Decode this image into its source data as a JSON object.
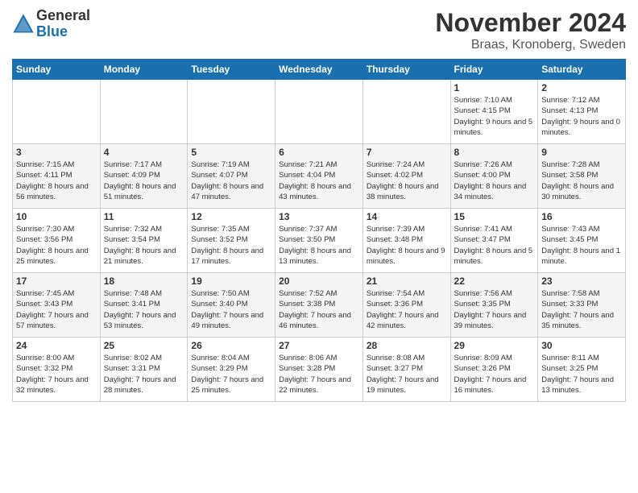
{
  "logo": {
    "general": "General",
    "blue": "Blue"
  },
  "title": "November 2024",
  "subtitle": "Braas, Kronoberg, Sweden",
  "headers": [
    "Sunday",
    "Monday",
    "Tuesday",
    "Wednesday",
    "Thursday",
    "Friday",
    "Saturday"
  ],
  "weeks": [
    [
      {
        "day": "",
        "sunrise": "",
        "sunset": "",
        "daylight": ""
      },
      {
        "day": "",
        "sunrise": "",
        "sunset": "",
        "daylight": ""
      },
      {
        "day": "",
        "sunrise": "",
        "sunset": "",
        "daylight": ""
      },
      {
        "day": "",
        "sunrise": "",
        "sunset": "",
        "daylight": ""
      },
      {
        "day": "",
        "sunrise": "",
        "sunset": "",
        "daylight": ""
      },
      {
        "day": "1",
        "sunrise": "Sunrise: 7:10 AM",
        "sunset": "Sunset: 4:15 PM",
        "daylight": "Daylight: 9 hours and 5 minutes."
      },
      {
        "day": "2",
        "sunrise": "Sunrise: 7:12 AM",
        "sunset": "Sunset: 4:13 PM",
        "daylight": "Daylight: 9 hours and 0 minutes."
      }
    ],
    [
      {
        "day": "3",
        "sunrise": "Sunrise: 7:15 AM",
        "sunset": "Sunset: 4:11 PM",
        "daylight": "Daylight: 8 hours and 56 minutes."
      },
      {
        "day": "4",
        "sunrise": "Sunrise: 7:17 AM",
        "sunset": "Sunset: 4:09 PM",
        "daylight": "Daylight: 8 hours and 51 minutes."
      },
      {
        "day": "5",
        "sunrise": "Sunrise: 7:19 AM",
        "sunset": "Sunset: 4:07 PM",
        "daylight": "Daylight: 8 hours and 47 minutes."
      },
      {
        "day": "6",
        "sunrise": "Sunrise: 7:21 AM",
        "sunset": "Sunset: 4:04 PM",
        "daylight": "Daylight: 8 hours and 43 minutes."
      },
      {
        "day": "7",
        "sunrise": "Sunrise: 7:24 AM",
        "sunset": "Sunset: 4:02 PM",
        "daylight": "Daylight: 8 hours and 38 minutes."
      },
      {
        "day": "8",
        "sunrise": "Sunrise: 7:26 AM",
        "sunset": "Sunset: 4:00 PM",
        "daylight": "Daylight: 8 hours and 34 minutes."
      },
      {
        "day": "9",
        "sunrise": "Sunrise: 7:28 AM",
        "sunset": "Sunset: 3:58 PM",
        "daylight": "Daylight: 8 hours and 30 minutes."
      }
    ],
    [
      {
        "day": "10",
        "sunrise": "Sunrise: 7:30 AM",
        "sunset": "Sunset: 3:56 PM",
        "daylight": "Daylight: 8 hours and 25 minutes."
      },
      {
        "day": "11",
        "sunrise": "Sunrise: 7:32 AM",
        "sunset": "Sunset: 3:54 PM",
        "daylight": "Daylight: 8 hours and 21 minutes."
      },
      {
        "day": "12",
        "sunrise": "Sunrise: 7:35 AM",
        "sunset": "Sunset: 3:52 PM",
        "daylight": "Daylight: 8 hours and 17 minutes."
      },
      {
        "day": "13",
        "sunrise": "Sunrise: 7:37 AM",
        "sunset": "Sunset: 3:50 PM",
        "daylight": "Daylight: 8 hours and 13 minutes."
      },
      {
        "day": "14",
        "sunrise": "Sunrise: 7:39 AM",
        "sunset": "Sunset: 3:48 PM",
        "daylight": "Daylight: 8 hours and 9 minutes."
      },
      {
        "day": "15",
        "sunrise": "Sunrise: 7:41 AM",
        "sunset": "Sunset: 3:47 PM",
        "daylight": "Daylight: 8 hours and 5 minutes."
      },
      {
        "day": "16",
        "sunrise": "Sunrise: 7:43 AM",
        "sunset": "Sunset: 3:45 PM",
        "daylight": "Daylight: 8 hours and 1 minute."
      }
    ],
    [
      {
        "day": "17",
        "sunrise": "Sunrise: 7:45 AM",
        "sunset": "Sunset: 3:43 PM",
        "daylight": "Daylight: 7 hours and 57 minutes."
      },
      {
        "day": "18",
        "sunrise": "Sunrise: 7:48 AM",
        "sunset": "Sunset: 3:41 PM",
        "daylight": "Daylight: 7 hours and 53 minutes."
      },
      {
        "day": "19",
        "sunrise": "Sunrise: 7:50 AM",
        "sunset": "Sunset: 3:40 PM",
        "daylight": "Daylight: 7 hours and 49 minutes."
      },
      {
        "day": "20",
        "sunrise": "Sunrise: 7:52 AM",
        "sunset": "Sunset: 3:38 PM",
        "daylight": "Daylight: 7 hours and 46 minutes."
      },
      {
        "day": "21",
        "sunrise": "Sunrise: 7:54 AM",
        "sunset": "Sunset: 3:36 PM",
        "daylight": "Daylight: 7 hours and 42 minutes."
      },
      {
        "day": "22",
        "sunrise": "Sunrise: 7:56 AM",
        "sunset": "Sunset: 3:35 PM",
        "daylight": "Daylight: 7 hours and 39 minutes."
      },
      {
        "day": "23",
        "sunrise": "Sunrise: 7:58 AM",
        "sunset": "Sunset: 3:33 PM",
        "daylight": "Daylight: 7 hours and 35 minutes."
      }
    ],
    [
      {
        "day": "24",
        "sunrise": "Sunrise: 8:00 AM",
        "sunset": "Sunset: 3:32 PM",
        "daylight": "Daylight: 7 hours and 32 minutes."
      },
      {
        "day": "25",
        "sunrise": "Sunrise: 8:02 AM",
        "sunset": "Sunset: 3:31 PM",
        "daylight": "Daylight: 7 hours and 28 minutes."
      },
      {
        "day": "26",
        "sunrise": "Sunrise: 8:04 AM",
        "sunset": "Sunset: 3:29 PM",
        "daylight": "Daylight: 7 hours and 25 minutes."
      },
      {
        "day": "27",
        "sunrise": "Sunrise: 8:06 AM",
        "sunset": "Sunset: 3:28 PM",
        "daylight": "Daylight: 7 hours and 22 minutes."
      },
      {
        "day": "28",
        "sunrise": "Sunrise: 8:08 AM",
        "sunset": "Sunset: 3:27 PM",
        "daylight": "Daylight: 7 hours and 19 minutes."
      },
      {
        "day": "29",
        "sunrise": "Sunrise: 8:09 AM",
        "sunset": "Sunset: 3:26 PM",
        "daylight": "Daylight: 7 hours and 16 minutes."
      },
      {
        "day": "30",
        "sunrise": "Sunrise: 8:11 AM",
        "sunset": "Sunset: 3:25 PM",
        "daylight": "Daylight: 7 hours and 13 minutes."
      }
    ]
  ]
}
